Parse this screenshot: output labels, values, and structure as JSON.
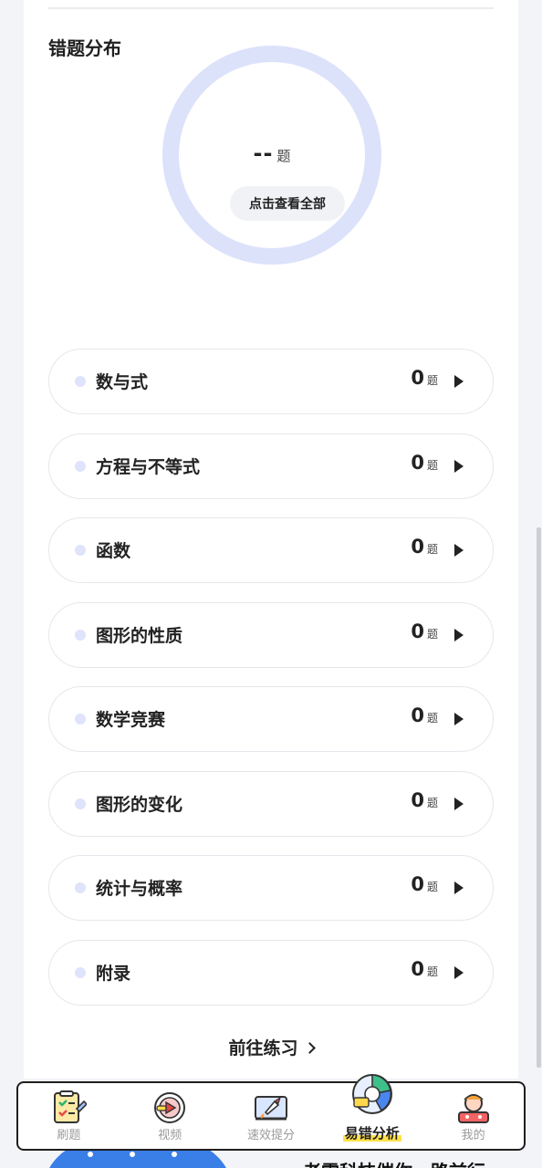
{
  "section_title": "错题分布",
  "summary": {
    "count": "--",
    "unit": "题",
    "view_all_label": "点击查看全部"
  },
  "categories": [
    {
      "name": "数与式",
      "count": "0",
      "unit": "题"
    },
    {
      "name": "方程与不等式",
      "count": "0",
      "unit": "题"
    },
    {
      "name": "函数",
      "count": "0",
      "unit": "题"
    },
    {
      "name": "图形的性质",
      "count": "0",
      "unit": "题"
    },
    {
      "name": "数学竞赛",
      "count": "0",
      "unit": "题"
    },
    {
      "name": "图形的变化",
      "count": "0",
      "unit": "题"
    },
    {
      "name": "统计与概率",
      "count": "0",
      "unit": "题"
    },
    {
      "name": "附录",
      "count": "0",
      "unit": "题"
    }
  ],
  "goto_practice_label": "前往练习",
  "bottom_text": "老雷科技催你一路前行",
  "tabbar": {
    "active": "易错分析",
    "tabs": [
      {
        "label": "刷题",
        "icon": "checklist-icon"
      },
      {
        "label": "视频",
        "icon": "video-play-icon"
      },
      {
        "label": "速效提分",
        "icon": "rocket-icon"
      },
      {
        "label": "易错分析",
        "icon": "analysis-chart-icon"
      },
      {
        "label": "我的",
        "icon": "profile-icon"
      }
    ]
  },
  "colors": {
    "ring": "#dde2fb",
    "accent_underline": "#ffe14a",
    "tab_inactive": "#9a9a9a"
  }
}
